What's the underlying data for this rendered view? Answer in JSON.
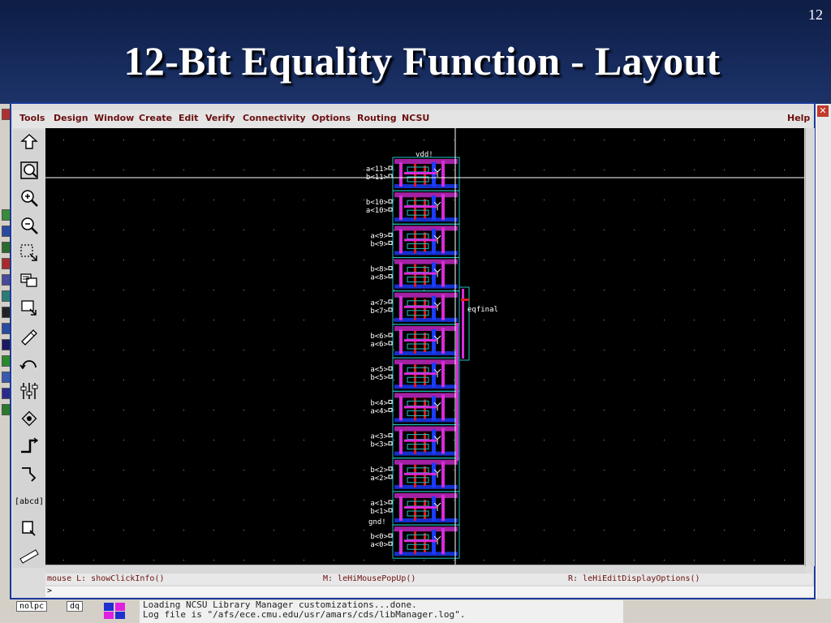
{
  "slide": {
    "title": "12-Bit Equality Function - Layout",
    "number": "12"
  },
  "menubar": {
    "items": [
      "Tools",
      "Design",
      "Window",
      "Create",
      "Edit",
      "Verify",
      "Connectivity",
      "Options",
      "Routing",
      "NCSU"
    ],
    "help": "Help"
  },
  "palette": {
    "tools": [
      "save-icon",
      "fit-view-icon",
      "zoom-in-icon",
      "zoom-out-icon",
      "stretch-icon",
      "copy-icon",
      "move-icon",
      "delete-icon",
      "undo-icon",
      "property-icon",
      "instance-icon",
      "path-icon",
      "polygon-icon",
      "label-icon",
      "rectangle-icon",
      "ruler-icon"
    ],
    "label_tool_text": "[abcd]"
  },
  "canvas": {
    "background": "#000000",
    "power_labels": {
      "vdd": "vdd!",
      "gnd": "gnd!",
      "output": "eqfinal"
    },
    "pin_labels": [
      "a<11>",
      "b<11>",
      "b<10>",
      "a<10>",
      "a<9>",
      "b<9>",
      "b<8>",
      "a<8>",
      "a<7>",
      "b<7>",
      "b<6>",
      "a<6>",
      "a<5>",
      "b<5>",
      "b<4>",
      "a<4>",
      "a<3>",
      "b<3>",
      "b<2>",
      "a<2>",
      "a<1>",
      "b<1>",
      "b<0>",
      "a<0>"
    ]
  },
  "statusbar": {
    "left": "mouse L: showClickInfo()",
    "middle": "M: leHiMousePopUp()",
    "right": "R: leHiEditDisplayOptions()"
  },
  "cmdline": {
    "prompt": ">"
  },
  "taskbar": {
    "item1": "nolpc",
    "item2": "dq"
  },
  "ciw": {
    "line1": "Loading NCSU Library Manager customizations...done.",
    "line2": "Log file is \"/afs/ece.cmu.edu/usr/amars/cds/libManager.log\"."
  },
  "colors": {
    "header": "#15295a",
    "menu_text": "#6b1010",
    "metal1": "#1a3cff",
    "metal2": "#d92cd9",
    "poly": "#e01a1a",
    "active": "#22c0c0"
  }
}
